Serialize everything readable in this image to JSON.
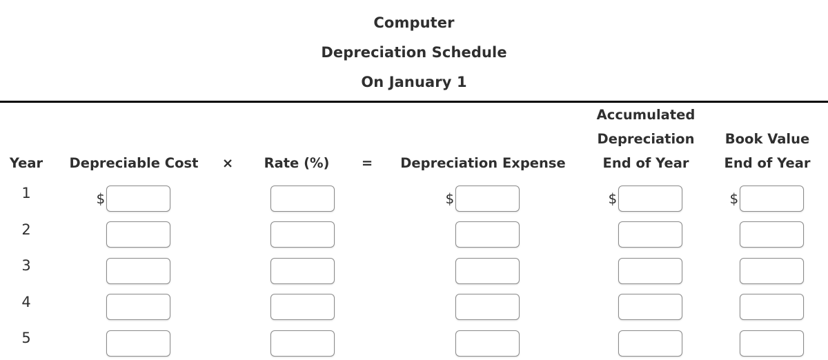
{
  "title": {
    "line1": "Computer",
    "line2": "Depreciation Schedule",
    "line3": "On January 1"
  },
  "table": {
    "headers": {
      "year": "Year",
      "depreciable_cost": "Depreciable Cost",
      "operator_times": "×",
      "rate": "Rate (%)",
      "operator_equals": "=",
      "depreciation_expense": "Depreciation Expense",
      "accumulated_line1": "Accumulated",
      "accumulated_line2": "Depreciation",
      "accumulated_line3": "End of Year",
      "book_value_line1": "Book Value",
      "book_value_line2": "End of Year"
    },
    "currency_symbol": "$",
    "input_placeholder": "",
    "rows": [
      {
        "year": "1",
        "depreciable_cost": "",
        "rate": "",
        "depreciation_expense": "",
        "accumulated_depreciation": "",
        "book_value": "",
        "show_currency": true
      },
      {
        "year": "2",
        "depreciable_cost": "",
        "rate": "",
        "depreciation_expense": "",
        "accumulated_depreciation": "",
        "book_value": "",
        "show_currency": false
      },
      {
        "year": "3",
        "depreciable_cost": "",
        "rate": "",
        "depreciation_expense": "",
        "accumulated_depreciation": "",
        "book_value": "",
        "show_currency": false
      },
      {
        "year": "4",
        "depreciable_cost": "",
        "rate": "",
        "depreciation_expense": "",
        "accumulated_depreciation": "",
        "book_value": "",
        "show_currency": false
      },
      {
        "year": "5",
        "depreciable_cost": "",
        "rate": "",
        "depreciation_expense": "",
        "accumulated_depreciation": "",
        "book_value": "",
        "show_currency": false
      }
    ]
  },
  "style": {
    "text_color": "#2f2f2f",
    "rule_color": "#000000",
    "input_border_color": "#8a8a8a",
    "background": "#ffffff"
  }
}
